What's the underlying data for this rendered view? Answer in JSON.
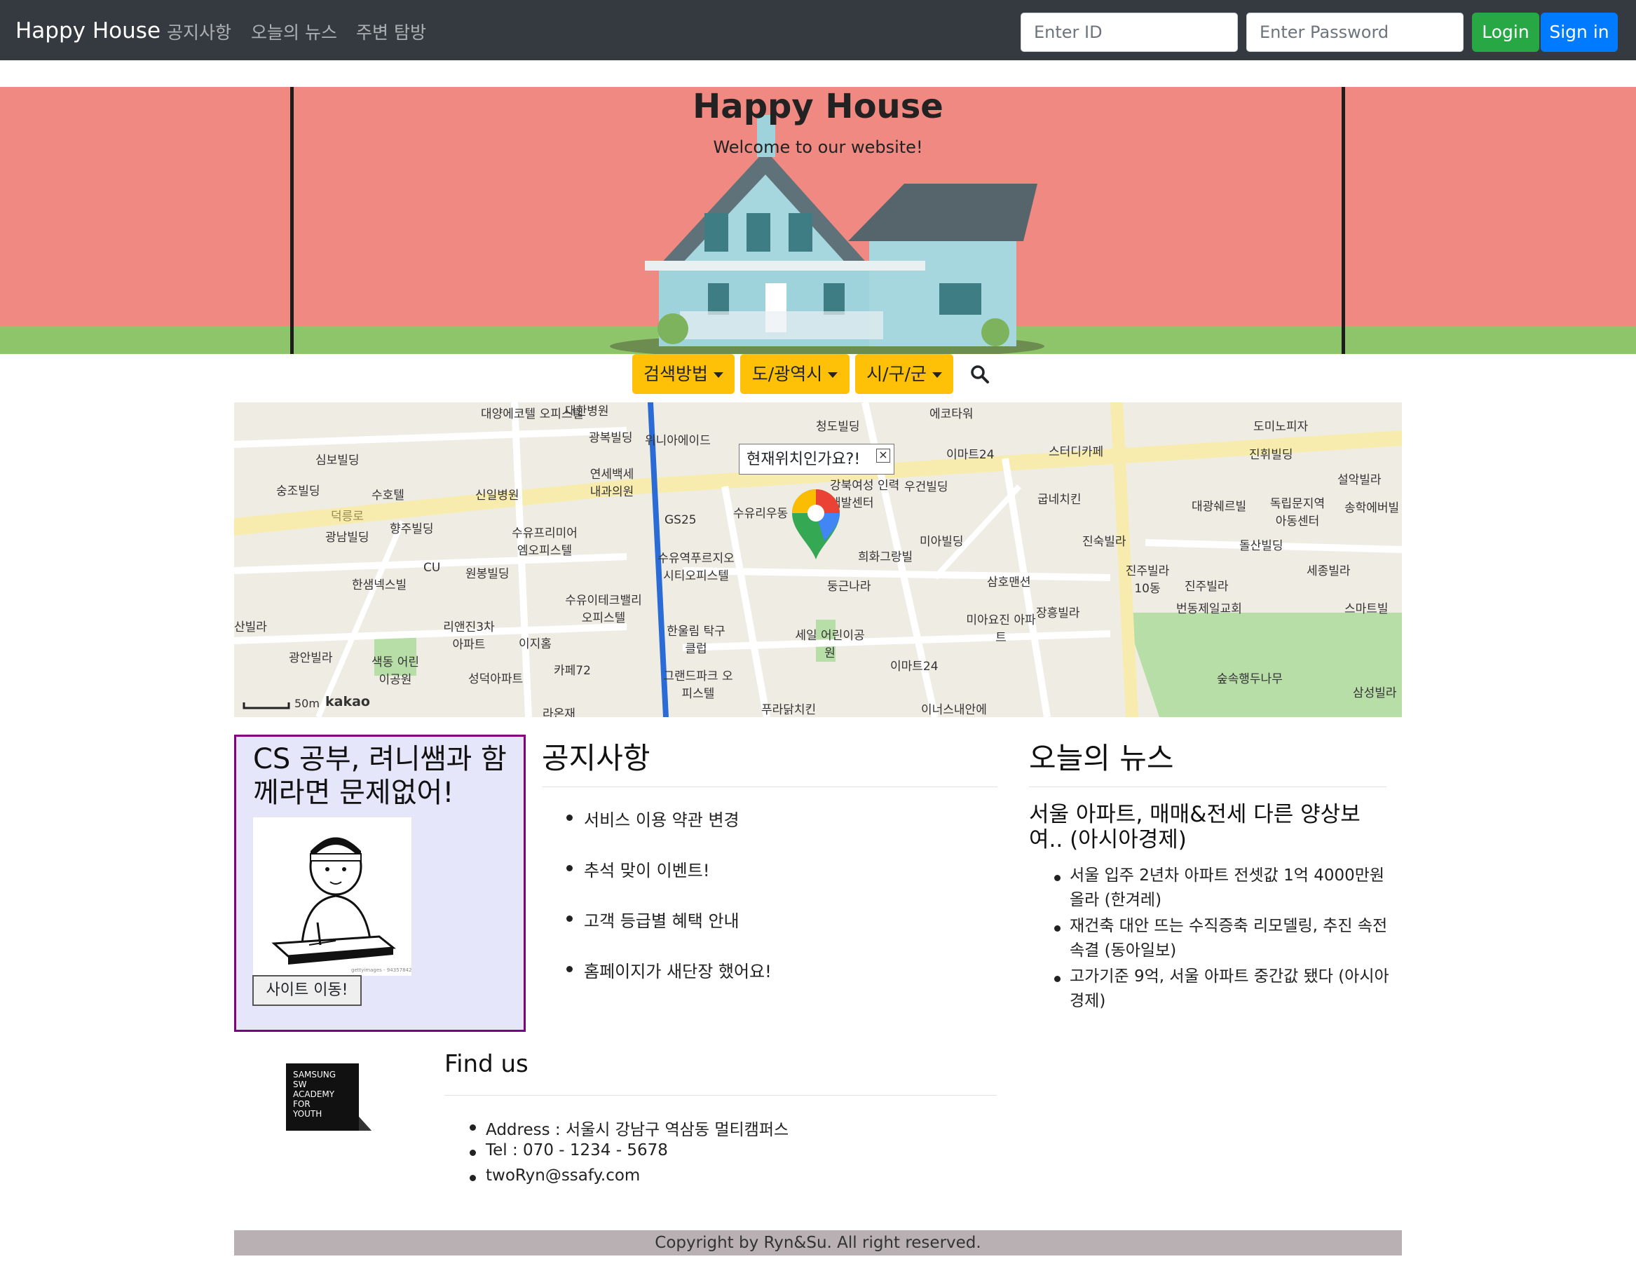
{
  "navbar": {
    "brand": "Happy House",
    "links": [
      "공지사항",
      "오늘의 뉴스",
      "주변 탐방"
    ],
    "id_placeholder": "Enter ID",
    "password_placeholder": "Enter Password",
    "login_label": "Login",
    "signin_label": "Sign in",
    "login_color": "#28a745",
    "signin_color": "#007bff"
  },
  "banner": {
    "title": "Happy House",
    "subtitle": "Welcome to our website!"
  },
  "search": {
    "method_label": "검색방법",
    "province_label": "도/광역시",
    "district_label": "시/구/군",
    "search_icon": "search-icon",
    "accent_color": "#ffc107"
  },
  "map": {
    "popup_text": "현재위치인가요?!",
    "close_glyph": "×",
    "scale_label": "50m",
    "provider": "kakao",
    "labels": [
      "대양에코텔 오피스텔",
      "대한병원",
      "청도빌딩",
      "에코타워",
      "도미노피자",
      "광복빌딩",
      "위니아에이드",
      "이마트24",
      "스터디카페",
      "진휘빌딩",
      "심보빌딩",
      "숭조빌딩",
      "수호텔",
      "신일병원",
      "연세백세 내과의원",
      "덕릉로",
      "수유리우동",
      "강북여성 인력개발센터",
      "우건빌딩",
      "굽네치킨",
      "설악빌라",
      "송학에버빌",
      "대광쉐르빌",
      "독립문지역 아동센터",
      "광남빌딩",
      "향주빌딩",
      "CU",
      "수유프리미어 엠오피스텔",
      "GS25",
      "희화그랑빌",
      "미아빌딩",
      "진숙빌라",
      "돌산빌딩",
      "수유역푸르지오 시티오피스텔",
      "원봉빌딩",
      "한샘넥스빌",
      "둥근나라",
      "삼호맨션",
      "진주빌라 10동",
      "진주빌라",
      "세종빌라",
      "수유이테크밸리 오피스텔",
      "리앤진3차 아파트",
      "이지홈",
      "한울림 탁구클럽",
      "세일 어린이공원",
      "미아요진 아파트",
      "장흥빌라",
      "번동제일교회",
      "스마트빌",
      "산빌라",
      "광안빌라",
      "색동 어린이공원",
      "성덕아파트",
      "카페72",
      "그랜드파크 오피스텔",
      "이마트24",
      "숲속행두나무",
      "푸라닭치킨",
      "이너스내안에",
      "삼성빌라",
      "라온재"
    ]
  },
  "promo": {
    "title": "CS 공부, 려니쌤과 함께라면 문제없어!",
    "button_label": "사이트 이동!",
    "image_watermark": "gettyimages - 94357842"
  },
  "notice": {
    "heading": "공지사항",
    "items": [
      "서비스 이용 약관 변경",
      "추석 맞이 이벤트!",
      "고객 등급별 혜택 안내",
      "홈페이지가 새단장 했어요!"
    ]
  },
  "news": {
    "heading": "오늘의 뉴스",
    "headline": "서울 아파트, 매매&전세 다른 양상보여.. (아시아경제)",
    "items": [
      "서울 입주 2년차 아파트 전셋값 1억 4000만원 올라 (한겨레)",
      "재건축 대안 뜨는 수직증축 리모델링, 추진 속전속결 (동아일보)",
      "고가기준 9억, 서울 아파트 중간값 됐다 (아시아경제)"
    ]
  },
  "findus": {
    "heading": "Find us",
    "logo_text": "SAMSUNG SW ACADEMY FOR YOUTH",
    "address": "Address : 서울시 강남구 역삼동 멀티캠퍼스",
    "tel": "Tel : 070 - 1234 - 5678",
    "email": "twoRyn@ssafy.com"
  },
  "footer": {
    "text": "Copyright by Ryn&Su. All right reserved."
  }
}
